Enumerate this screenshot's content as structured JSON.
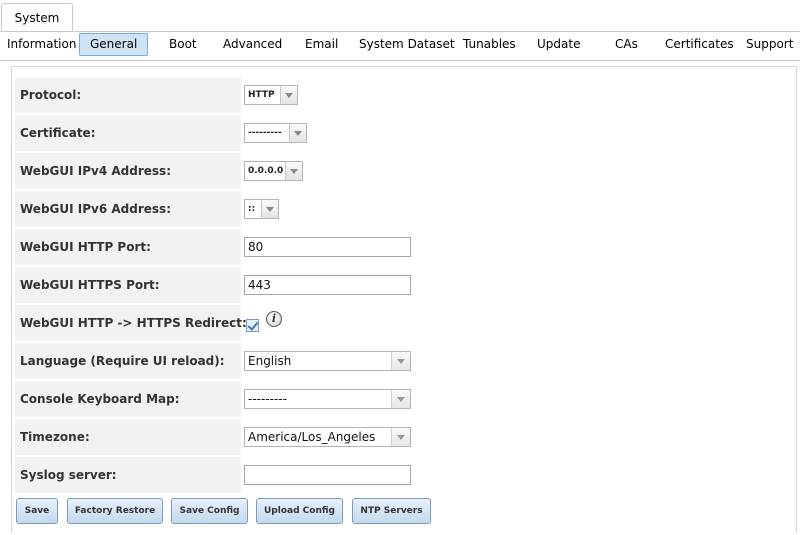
{
  "top_tabs": {
    "system": "System"
  },
  "subtabs": [
    {
      "label": "Information"
    },
    {
      "label": "General"
    },
    {
      "label": "Boot"
    },
    {
      "label": "Advanced"
    },
    {
      "label": "Email"
    },
    {
      "label": "System Dataset"
    },
    {
      "label": "Tunables"
    },
    {
      "label": "Update"
    },
    {
      "label": "CAs"
    },
    {
      "label": "Certificates"
    },
    {
      "label": "Support"
    }
  ],
  "form": {
    "protocol": {
      "label": "Protocol:",
      "value": "HTTP"
    },
    "certificate": {
      "label": "Certificate:",
      "value": "---------"
    },
    "ipv4": {
      "label": "WebGUI IPv4 Address:",
      "value": "0.0.0.0"
    },
    "ipv6": {
      "label": "WebGUI IPv6 Address:",
      "value": "::"
    },
    "http_port": {
      "label": "WebGUI HTTP Port:",
      "value": "80"
    },
    "https_port": {
      "label": "WebGUI HTTPS Port:",
      "value": "443"
    },
    "redirect": {
      "label": "WebGUI HTTP -> HTTPS Redirect:",
      "checked": true
    },
    "language": {
      "label": "Language (Require UI reload):",
      "value": "English"
    },
    "keymap": {
      "label": "Console Keyboard Map:",
      "value": "---------"
    },
    "timezone": {
      "label": "Timezone:",
      "value": "America/Los_Angeles"
    },
    "syslog": {
      "label": "Syslog server:",
      "value": ""
    }
  },
  "buttons": {
    "save": "Save",
    "factory_restore": "Factory Restore",
    "save_config": "Save Config",
    "upload_config": "Upload Config",
    "ntp_servers": "NTP Servers"
  },
  "icons": {
    "info": "info-icon",
    "checkbox": "checkmark-icon",
    "dropdown": "chevron-down-icon"
  },
  "colors": {
    "active_tab_bg": "#cfe3f7",
    "label_bg": "#f2f2f2",
    "button_bg": "#c4d9ee"
  }
}
